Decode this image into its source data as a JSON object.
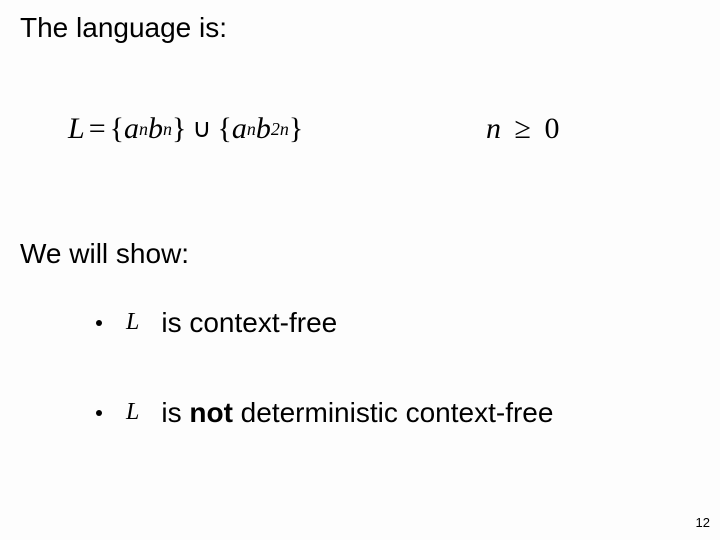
{
  "heading1": "The language is:",
  "heading2": "We will show:",
  "formula": {
    "L": "L",
    "eq": "=",
    "lbrace": "{",
    "rbrace": "}",
    "a": "a",
    "b": "b",
    "n": "n",
    "two_n": "2n",
    "cup": "∪",
    "cond_var": "n",
    "cond_op": "≥",
    "cond_rhs": "0"
  },
  "bullets": {
    "L": "L",
    "item1_text": "is context-free",
    "item2_pre": "is ",
    "item2_bold": "not",
    "item2_post": " deterministic context-free"
  },
  "page": "12"
}
